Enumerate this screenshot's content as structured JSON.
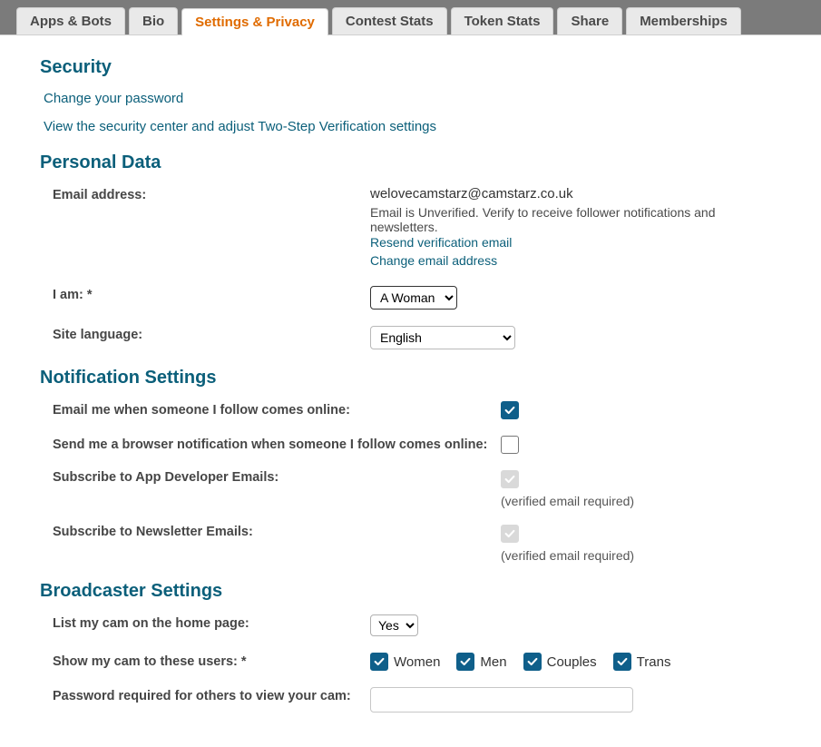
{
  "tabs": [
    {
      "label": "Apps & Bots"
    },
    {
      "label": "Bio"
    },
    {
      "label": "Settings & Privacy"
    },
    {
      "label": "Contest Stats"
    },
    {
      "label": "Token Stats"
    },
    {
      "label": "Share"
    },
    {
      "label": "Memberships"
    }
  ],
  "security": {
    "heading": "Security",
    "change_password": "Change your password",
    "security_center": "View the security center and adjust Two-Step Verification settings"
  },
  "personal_data": {
    "heading": "Personal Data",
    "email_label": "Email address:",
    "email_value": "welovecamstarz@camstarz.co.uk",
    "email_status": "Email is Unverified. Verify to receive follower notifications and newsletters.",
    "resend_link": "Resend verification email",
    "change_email_link": "Change email address",
    "iam_label": "I am: *",
    "iam_value": "A Woman",
    "site_lang_label": "Site language:",
    "site_lang_value": "English"
  },
  "notifications": {
    "heading": "Notification Settings",
    "email_follow_label": "Email me when someone I follow comes online:",
    "browser_follow_label": "Send me a browser notification when someone I follow comes online:",
    "dev_emails_label": "Subscribe to App Developer Emails:",
    "newsletter_label": "Subscribe to Newsletter Emails:",
    "verified_required": "(verified email required)"
  },
  "broadcaster": {
    "heading": "Broadcaster Settings",
    "list_cam_label": "List my cam on the home page:",
    "list_cam_value": "Yes",
    "show_cam_label": "Show my cam to these users: *",
    "users": [
      {
        "label": "Women"
      },
      {
        "label": "Men"
      },
      {
        "label": "Couples"
      },
      {
        "label": "Trans"
      }
    ],
    "password_label": "Password required for others to view your cam:"
  }
}
